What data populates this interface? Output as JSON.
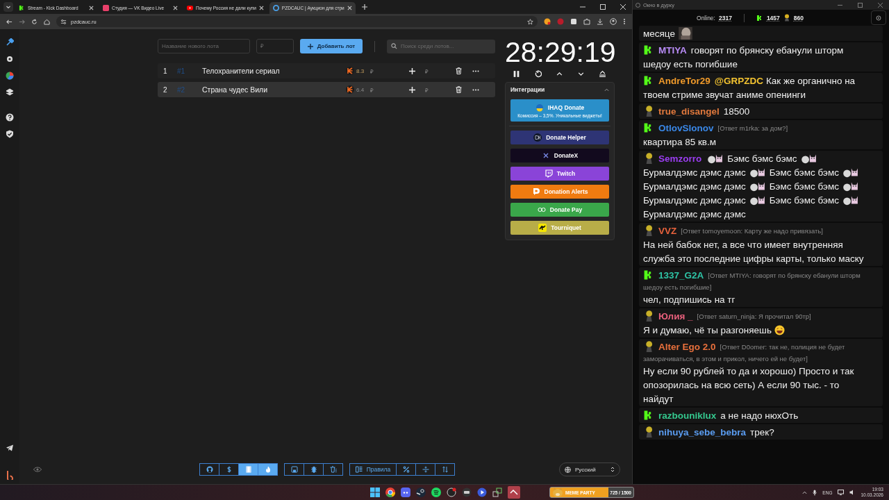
{
  "browser": {
    "tabs": [
      {
        "title": "Stream - Kick Dashboard",
        "kind": "kick",
        "selected": false
      },
      {
        "title": "Студия — VK Видео Live",
        "kind": "vk",
        "selected": false
      },
      {
        "title": "Почему Россия не дали купи",
        "kind": "youtube",
        "selected": false
      },
      {
        "title": "PZDCAUC | Аукцион для стри",
        "kind": "site",
        "selected": true
      }
    ],
    "address": "pzdcauc.ru"
  },
  "sidebar": {
    "items": [
      {
        "kind": "hammer",
        "selected": true
      },
      {
        "kind": "gear",
        "selected": false
      },
      {
        "kind": "pie",
        "selected": false
      },
      {
        "kind": "layers",
        "selected": false
      }
    ]
  },
  "lot_form": {
    "name_placeholder": "Название нового лота",
    "price_placeholder": "₽",
    "add_button": "Добавить лот",
    "search_placeholder": "Поиск среди лотов..."
  },
  "lots": [
    {
      "number": "1",
      "id": "#1",
      "name": "Телохранители сериал",
      "rating": "8.3",
      "currency": "₽",
      "add_currency": "₽",
      "selected": false
    },
    {
      "number": "2",
      "id": "#2",
      "name": "Страна чудес Вили",
      "rating": "6.4",
      "currency": "₽",
      "add_currency": "₽",
      "selected": true
    }
  ],
  "timer": "28:29:19",
  "integrations": {
    "title": "Интеграции",
    "items": [
      {
        "name": "IHAQ Donate",
        "subtitle": "Комиссия – 3,5%. Уникальные виджеты!",
        "kind": "ihaq",
        "color": "#2a8fc9"
      },
      {
        "name": "Donate Helper",
        "kind": "dh",
        "color": "#2e3475"
      },
      {
        "name": "DonateX",
        "kind": "x",
        "color": "#120a1e"
      },
      {
        "name": "Twitch",
        "kind": "twitch",
        "color": "#8a44d8"
      },
      {
        "name": "Donation Alerts",
        "kind": "da",
        "color": "#f07b10"
      },
      {
        "name": "Donate Pay",
        "kind": "pay",
        "color": "#3aa74a"
      },
      {
        "name": "Tourniquet",
        "kind": "tourniquet",
        "color": "#b8ad48"
      }
    ]
  },
  "toolbar": [
    [
      {
        "kind": "github",
        "selected": false
      },
      {
        "kind": "dollar",
        "selected": false
      },
      {
        "kind": "film",
        "selected": true
      },
      {
        "kind": "fire",
        "selected": true
      }
    ],
    [
      {
        "kind": "save",
        "selected": false
      },
      {
        "kind": "bug",
        "selected": false
      },
      {
        "kind": "trash",
        "selected": false
      }
    ],
    [
      {
        "kind": "list",
        "label": "Правила",
        "selected": false
      },
      {
        "kind": "percent",
        "selected": false
      },
      {
        "kind": "split",
        "selected": false
      },
      {
        "kind": "sort",
        "selected": false
      }
    ]
  ],
  "language": "Русский",
  "chat": {
    "window_title": "Окно в дурку",
    "online_label": "Online:",
    "online": "2317",
    "kick_count": "1457",
    "other_count": "860",
    "messages": [
      {
        "lines": [
          [
            {
              "text": "месяце"
            }
          ]
        ]
      },
      {
        "kind": "kick",
        "user": "MTIYA",
        "color": "#b98cf7",
        "lines": [
          [
            {
              "text": "говорят по брянску ебанули шторм"
            }
          ],
          [
            {
              "text": "шедоу есть погибшие"
            }
          ]
        ]
      },
      {
        "kind": "kick",
        "user": "AndreTor29",
        "color": "#f09a2a",
        "mention": "@GRPZDC",
        "lines": [
          [
            {
              "text": "Как же органично на"
            }
          ],
          [
            {
              "text": "твоем стриме звучат аниме опенинги"
            }
          ]
        ]
      },
      {
        "kind": "other",
        "user": "true_disangel",
        "color": "#e0783c",
        "lines": [
          [
            {
              "text": "18500"
            }
          ]
        ]
      },
      {
        "kind": "kick",
        "user": "OtlovSlonov",
        "color": "#3a88e8",
        "reply": [
          "[Ответ m1rka: за дом?]"
        ],
        "lines": [
          [
            {
              "text": "квартира 85 кв.м"
            }
          ]
        ]
      },
      {
        "kind": "other",
        "user": "Semzorro",
        "color": "#9a3df0",
        "lead_emote": {
          "kind": "cat"
        },
        "lines": [
          [
            {
              "text": "Бэмс бэмс бэмс",
              "emote": {
                "kind": "cat"
              }
            }
          ],
          [
            {
              "text": "Бурмалдэмс дэмс дэмс",
              "emote": {
                "kind": "cat"
              }
            },
            {
              "text": "Бэмс бэмс бэмс",
              "emote": {
                "kind": "cat"
              }
            }
          ],
          [
            {
              "text": "Бурмалдэмс дэмс дэмс",
              "emote": {
                "kind": "cat"
              }
            },
            {
              "text": "Бэмс бэмс бэмс",
              "emote": {
                "kind": "cat"
              }
            }
          ],
          [
            {
              "text": "Бурмалдэмс дэмс дэмс",
              "emote": {
                "kind": "cat"
              }
            },
            {
              "text": "Бэмс бэмс бэмс",
              "emote": {
                "kind": "cat"
              }
            }
          ],
          [
            {
              "text": "Бурмалдэмс дэмс дэмс"
            }
          ]
        ]
      },
      {
        "kind": "other",
        "user": "VVZ",
        "color": "#e8623c",
        "reply": [
          "[Ответ tomoyemoon: Карту же надо привязать]"
        ],
        "lines": [
          [
            {
              "text": "На ней бабок нет, а все что имеет внутренняя"
            }
          ],
          [
            {
              "text": "служба это последние цифры карты, только маску"
            }
          ]
        ]
      },
      {
        "kind": "kick",
        "user": "1337_G2A",
        "color": "#2ec4a6",
        "reply": [
          "[Ответ MTIYA: говорят по брянску ебанули шторм",
          "шедоу есть погибшие]"
        ],
        "lines": [
          [
            {
              "text": "чел, подпишись на тг"
            }
          ]
        ]
      },
      {
        "kind": "other",
        "user": "Юлия _",
        "color": "#e8607c",
        "reply": [
          "[Ответ saturn_ninja: Я прочитал 90тр]"
        ],
        "lines": [
          [
            {
              "text": "Я и думаю, чё ты разгоняешь",
              "emote": {
                "kind": "laugh"
              }
            }
          ]
        ]
      },
      {
        "kind": "other",
        "user": "Alter Ego 2.0",
        "color": "#e8703c",
        "reply": [
          "[Ответ D0omer: так не, полиция не будет",
          "заморачиваться, в этом и прикол, ничего ей не будет]"
        ],
        "lines": [
          [
            {
              "text": "Ну если 90 рублей то да и хорошо) Просто и так"
            }
          ],
          [
            {
              "text": "опозорилась на всю сеть) А если 90 тыс. - то"
            }
          ],
          [
            {
              "text": "найдут"
            }
          ]
        ]
      },
      {
        "kind": "kick",
        "user": "razbouniklux",
        "color": "#34c88e",
        "lines": [
          [
            {
              "text": "а не надо нюхОть"
            }
          ]
        ]
      },
      {
        "kind": "other",
        "user": "nihuya_sebe_bebra",
        "color": "#5a9cf0",
        "lines": [
          [
            {
              "text": "трек?"
            }
          ]
        ]
      }
    ]
  },
  "taskbar": {
    "widget_title": "MEME PARTY",
    "widget_value": "725 / 1500",
    "language": "ENG",
    "time": "19:03",
    "date": "10.03.2026"
  }
}
